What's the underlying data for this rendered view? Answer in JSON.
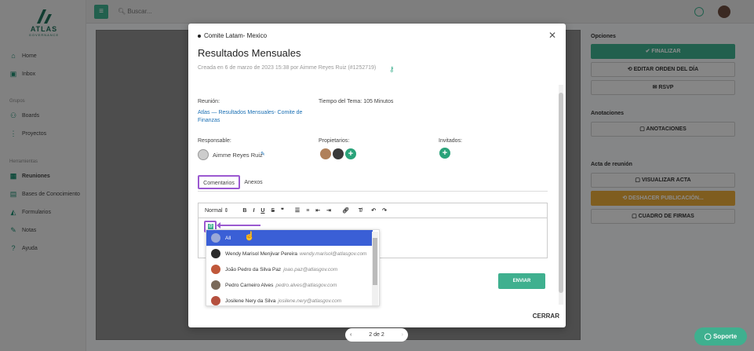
{
  "app": {
    "brand": "ATLAS",
    "brand_sub": "GOVERNANCE"
  },
  "sidebar": {
    "items": [
      {
        "label": "Home",
        "icon": "home-icon"
      },
      {
        "label": "Inbox",
        "icon": "inbox-icon"
      }
    ],
    "group_label": "Grupos",
    "group_items": [
      {
        "label": "Boards",
        "icon": "users-icon"
      },
      {
        "label": "Proyectos",
        "icon": "projects-icon"
      }
    ],
    "tools_label": "Herramientas",
    "tools_items": [
      {
        "label": "Reuniones",
        "icon": "calendar-icon"
      },
      {
        "label": "Bases de Conocimiento",
        "icon": "book-icon"
      },
      {
        "label": "Formularios",
        "icon": "form-icon"
      },
      {
        "label": "Notas",
        "icon": "note-icon"
      },
      {
        "label": "Ayuda",
        "icon": "help-icon"
      }
    ]
  },
  "topbar": {
    "search_placeholder": "Buscar..."
  },
  "right_panel": {
    "opciones": "Opciones",
    "finalizar": "✔ FINALIZAR",
    "editar": "⟲ EDITAR ORDEN DEL DÍA",
    "rsvp": "✉ RSVP",
    "anotaciones_label": "Anotaciones",
    "anotaciones_btn": "▢ ANOTACIONES",
    "acta_label": "Acta de reunión",
    "visualizar": "▢ VISUALIZAR ACTA",
    "deshacer": "⟲ DESHACER PUBLICACIÓN...",
    "firmas": "▢ CUADRO DE FIRMAS",
    "colors": {
      "finalizar": "#3fb08f",
      "deshacer": "#e8a93a"
    }
  },
  "modal": {
    "committee": "Comite Latam- Mexico",
    "title": "Resultados Mensuales",
    "created": "Creada en 6 de marzo de 2023 15:38 por Aimme Reyes Ruiz (#1252719)",
    "reunion_label": "Reunión:",
    "reunion_value": "Atlas — Resultados Mensuales- Comite de Finanzas",
    "tiempo_label": "Tiempo del Tema:",
    "tiempo_value": "105 Minutos",
    "responsable_label": "Responsable:",
    "responsable_value": "Aimme Reyes Ruiz",
    "propietarios_label": "Propietarios:",
    "invitados_label": "Invitados:",
    "tabs": [
      {
        "label": "Comentarios"
      },
      {
        "label": "Anexos"
      }
    ],
    "toolbar": {
      "format": "Normal"
    },
    "at_symbol": "@",
    "mentions": [
      {
        "name": "All",
        "email": ""
      },
      {
        "name": "Wendy Marisol Menjivar Pereira",
        "email": "wendy.marisol@atlasgov.com"
      },
      {
        "name": "João Pedro da Silva Paz",
        "email": "joao.paz@atlasgov.com"
      },
      {
        "name": "Pedro Carneiro Alves",
        "email": "pedro.alves@atlasgov.com"
      },
      {
        "name": "Josilene Nery da Silva",
        "email": "josilene.nery@atlasgov.com"
      }
    ],
    "send": "ENVIAR",
    "cerrar": "CERRAR"
  },
  "pager": {
    "text": "2 de 2"
  },
  "soporte": "Soporte"
}
